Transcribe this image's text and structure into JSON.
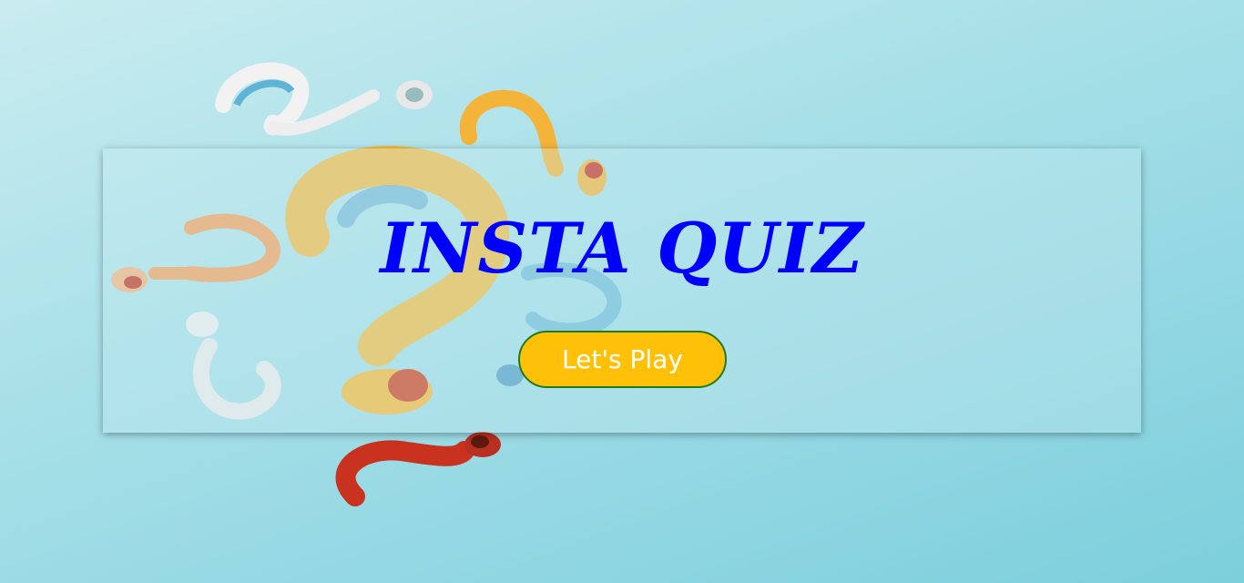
{
  "hero": {
    "title": "INSTA QUIZ",
    "play_button_label": "Let's Play"
  },
  "background": {
    "image": "question-marks-illustration",
    "colors": {
      "backdrop": "#a8e0e8",
      "orange": "#f4b43a",
      "red": "#c8321e",
      "blue": "#4aa9d4",
      "white": "#f5f5f5"
    }
  },
  "colors": {
    "title": "#0000ff",
    "button_fill": "#ffc107",
    "button_border": "#1f7a1f",
    "button_text": "#ffffff"
  }
}
